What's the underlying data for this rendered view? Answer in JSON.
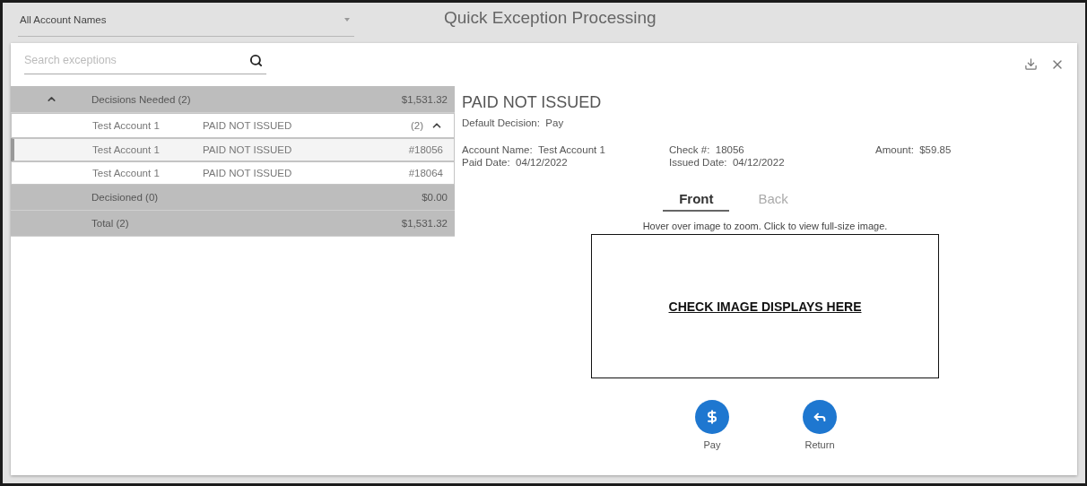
{
  "account_filter": {
    "value": "All Account Names"
  },
  "title": "Quick Exception Processing",
  "search": {
    "placeholder": "Search exceptions"
  },
  "decisions_needed": {
    "label": "Decisions Needed (2)",
    "amount": "$1,531.32",
    "expanded": true,
    "subgroup": {
      "account": "Test Account 1",
      "type": "PAID NOT ISSUED",
      "count": "(2)",
      "expanded": true,
      "items": [
        {
          "account": "Test Account 1",
          "type": "PAID NOT ISSUED",
          "check": "#18056",
          "selected": true
        },
        {
          "account": "Test Account 1",
          "type": "PAID NOT ISSUED",
          "check": "#18064",
          "selected": false
        }
      ]
    }
  },
  "summary_rows": [
    {
      "label": "Decisioned (0)",
      "amount": "$0.00"
    },
    {
      "label": "Total (2)",
      "amount": "$1,531.32"
    }
  ],
  "detail": {
    "title": "PAID NOT ISSUED",
    "default_decision": {
      "label": "Default Decision:",
      "value": "Pay"
    },
    "fields": [
      {
        "label": "Account Name:",
        "value": "Test Account 1"
      },
      {
        "label": "Check #:",
        "value": "18056"
      },
      {
        "label": "Amount:",
        "value": "$59.85"
      },
      {
        "label": "Paid Date:",
        "value": "04/12/2022"
      },
      {
        "label": "Issued Date:",
        "value": "04/12/2022"
      }
    ],
    "tabs": [
      {
        "label": "Front",
        "selected": true
      },
      {
        "label": "Back",
        "selected": false
      }
    ],
    "hint": "Hover over image to zoom. Click to view full-size image.",
    "image_placeholder": "CHECK IMAGE DISPLAYS HERE",
    "actions": [
      {
        "kind": "pay",
        "label": "Pay"
      },
      {
        "kind": "return",
        "label": "Return"
      }
    ]
  }
}
